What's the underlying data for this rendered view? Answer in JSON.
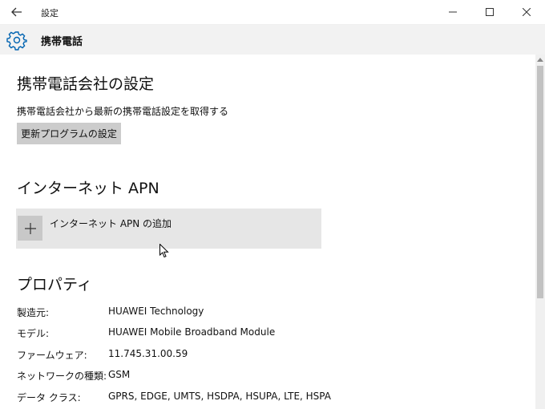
{
  "window": {
    "title": "設定"
  },
  "header": {
    "title": "携帯電話"
  },
  "carrier": {
    "heading": "携帯電話会社の設定",
    "description": "携帯電話会社から最新の携帯電話設定を取得する",
    "update_button": "更新プログラムの設定"
  },
  "apn": {
    "heading": "インターネット APN",
    "add_label": "インターネット APN の追加"
  },
  "properties": {
    "heading": "プロパティ",
    "rows": [
      {
        "key": "製造元:",
        "value": "HUAWEI Technology"
      },
      {
        "key": "モデル:",
        "value": "HUAWEI Mobile Broadband Module"
      },
      {
        "key": "ファームウェア:",
        "value": "11.745.31.00.59"
      },
      {
        "key": "ネットワークの種類:",
        "value": "GSM"
      },
      {
        "key": "データ クラス:",
        "value": "GPRS, EDGE, UMTS, HSDPA, HSUPA, LTE, HSPA"
      }
    ]
  },
  "icons": {
    "back": "back-arrow-icon",
    "gear": "gear-icon",
    "minimize": "minimize-icon",
    "maximize": "maximize-icon",
    "close": "close-icon",
    "plus": "plus-icon"
  },
  "colors": {
    "accent": "#0063b1",
    "header_bg": "#f2f2f2",
    "button_bg": "#cccccc"
  }
}
